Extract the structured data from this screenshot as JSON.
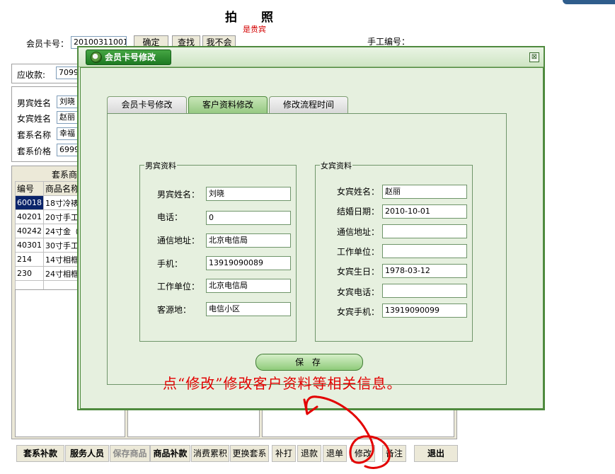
{
  "header": {
    "title": "拍　　照",
    "subtitle": "是贵宾"
  },
  "member": {
    "card_label": "会员卡号：",
    "card_value": "20100311001",
    "confirm": "确定",
    "search": "查找",
    "no": "我不会",
    "manual_label": "手工编号："
  },
  "receivable": {
    "label": "应收款:",
    "value": "7099."
  },
  "customer": {
    "groom_label": "男宾姓名",
    "groom_value": "刘晓",
    "bride_label": "女宾姓名",
    "bride_value": "赵丽",
    "package_label": "套系名称",
    "package_value": "幸福",
    "price_label": "套系价格",
    "price_value": "6999."
  },
  "products": {
    "title": "套系商",
    "headers": [
      "编号",
      "商品名称"
    ],
    "rows": [
      [
        "60018",
        "18寸冷裱"
      ],
      [
        "40201",
        "20寸手工"
      ],
      [
        "40242",
        "24寸金（"
      ],
      [
        "40301",
        "30寸手工"
      ],
      [
        "214",
        "14寸相框"
      ],
      [
        "230",
        "24寸相框"
      ]
    ]
  },
  "toolbar": [
    "套系补款",
    "服务人员",
    "保存商品",
    "商品补款",
    "消费累积",
    "更换套系",
    "补打",
    "退款",
    "退单",
    "修改",
    "备注",
    "退出"
  ],
  "dialog": {
    "title": "会员卡号修改",
    "close": "⊠",
    "tabs": [
      "会员卡号修改",
      "客户资料修改",
      "修改流程时间"
    ],
    "groom": {
      "legend": "男宾资料",
      "fields": [
        {
          "label": "男宾姓名：",
          "value": "刘晓"
        },
        {
          "label": "电话：",
          "value": "0"
        },
        {
          "label": "通信地址：",
          "value": "北京电信局"
        },
        {
          "label": "手机：",
          "value": "13919090089"
        },
        {
          "label": "工作单位：",
          "value": "北京电信局"
        },
        {
          "label": "客源地：",
          "value": "电信小区"
        }
      ]
    },
    "bride": {
      "legend": "女宾资料",
      "fields": [
        {
          "label": "女宾姓名：",
          "value": "赵丽"
        },
        {
          "label": "结婚日期：",
          "value": "2010-10-01"
        },
        {
          "label": "通信地址：",
          "value": ""
        },
        {
          "label": "工作单位：",
          "value": ""
        },
        {
          "label": "女宾生日：",
          "value": "1978-03-12"
        },
        {
          "label": "女宾电话：",
          "value": ""
        },
        {
          "label": "女宾手机：",
          "value": "13919090099"
        }
      ]
    },
    "save": "保 存"
  },
  "annotation": "点“修改”修改客户资料等相关信息。",
  "colors": {
    "annotation": "#e30000",
    "dialog_green": "#4f8a3e",
    "selection": "#0a246a"
  }
}
